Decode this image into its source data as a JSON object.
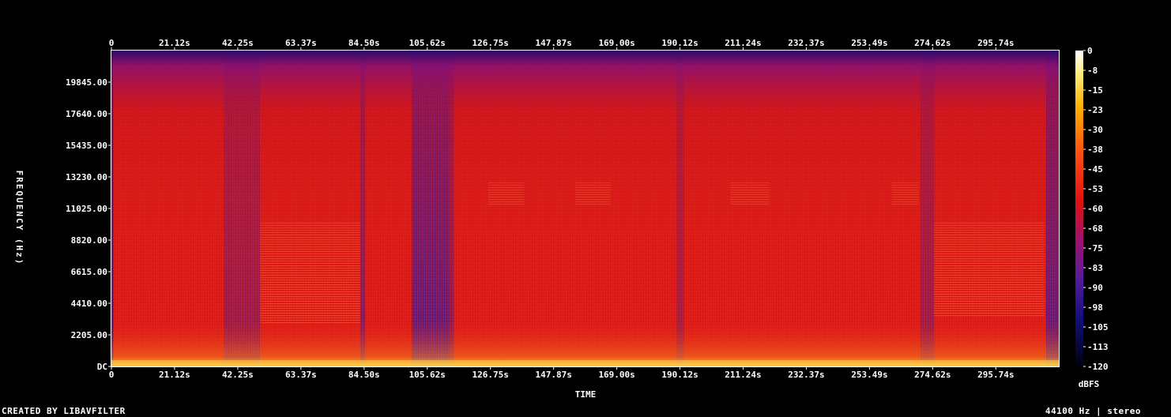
{
  "chart_data": {
    "type": "heatmap",
    "title": "",
    "xlabel": "TIME",
    "ylabel": "FREQUENCY (Hz)",
    "x_ticks": [
      "0",
      "21.12s",
      "42.25s",
      "63.37s",
      "84.50s",
      "105.62s",
      "126.75s",
      "147.87s",
      "169.00s",
      "190.12s",
      "211.24s",
      "232.37s",
      "253.49s",
      "274.62s",
      "295.74s"
    ],
    "x_tick_values": [
      0,
      21.12,
      42.25,
      63.37,
      84.5,
      105.62,
      126.75,
      147.87,
      169.0,
      190.12,
      211.24,
      232.37,
      253.49,
      274.62,
      295.74
    ],
    "xlim": [
      0,
      316.8
    ],
    "y_ticks": [
      "DC",
      "2205.00",
      "4410.00",
      "6615.00",
      "8820.00",
      "11025.00",
      "13230.00",
      "15435.00",
      "17640.00",
      "19845.00"
    ],
    "y_tick_values": [
      0,
      2205,
      4410,
      6615,
      8820,
      11025,
      13230,
      15435,
      17640,
      19845
    ],
    "ylim": [
      0,
      22050
    ],
    "colorbar": {
      "label": "dBFS",
      "ticks": [
        "0",
        "-8",
        "-15",
        "-23",
        "-30",
        "-38",
        "-45",
        "-53",
        "-60",
        "-68",
        "-75",
        "-83",
        "-90",
        "-98",
        "-105",
        "-113",
        "-120"
      ],
      "range": [
        -120,
        0
      ]
    },
    "colors": {
      "background": "#000000",
      "low": "#000010",
      "mid_low": "#5a1a9a",
      "mid": "#e01010",
      "mid_high": "#ff8000",
      "high": "#ffffff"
    }
  },
  "footer": {
    "credit": "CREATED BY LIBAVFILTER",
    "info": "44100 Hz | stereo"
  }
}
